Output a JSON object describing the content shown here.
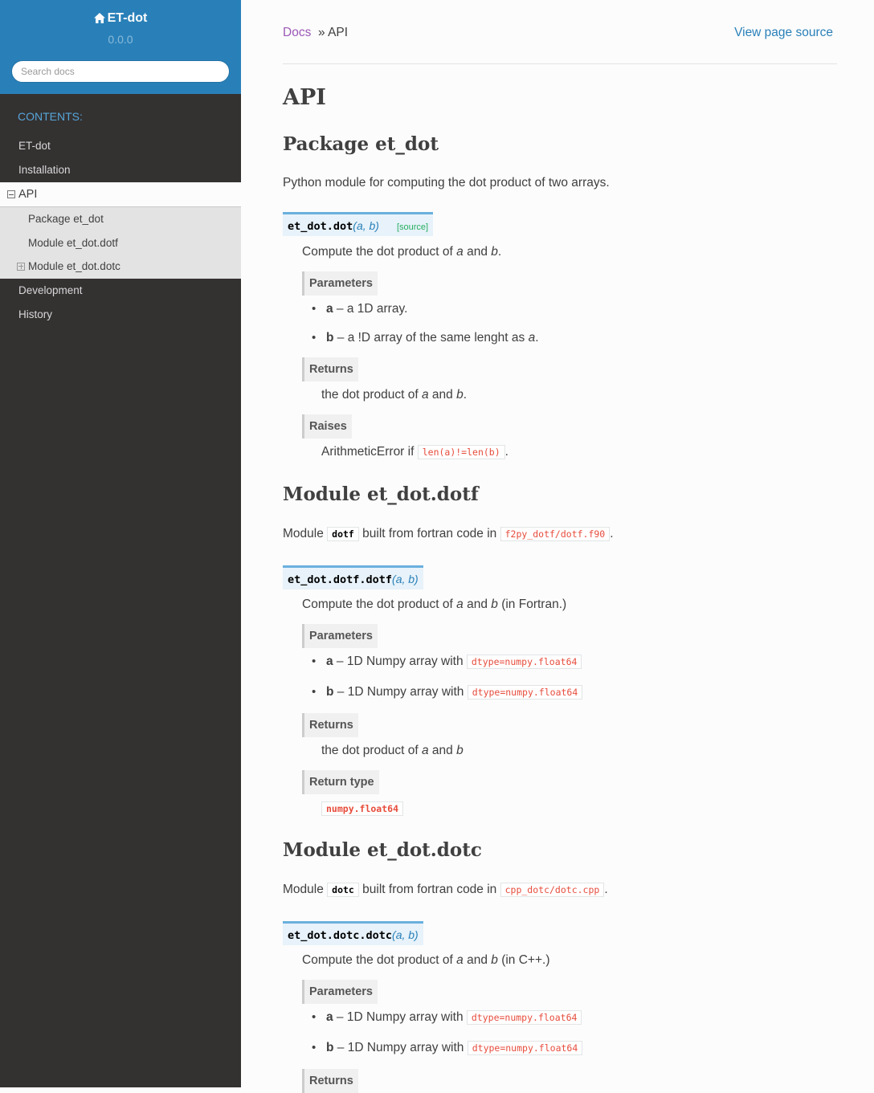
{
  "sidebar": {
    "project": "ET-dot",
    "version": "0.0.0",
    "search_placeholder": "Search docs",
    "caption": "CONTENTS:",
    "items": [
      {
        "label": "ET-dot"
      },
      {
        "label": "Installation"
      },
      {
        "label": "API"
      },
      {
        "label": "Development"
      },
      {
        "label": "History"
      }
    ],
    "subitems": [
      {
        "label": "Package et_dot"
      },
      {
        "label": "Module et_dot.dotf"
      },
      {
        "label": "Module et_dot.dotc"
      }
    ]
  },
  "breadcrumbs": {
    "docs": "Docs",
    "separator": "» API",
    "view_source": "View page source"
  },
  "page": {
    "title": "API",
    "pkg": {
      "heading": "Package et_dot",
      "intro": "Python module for computing the dot product of two arrays.",
      "sig_name": "et_dot.dot",
      "sig_args": "(a, b)",
      "source_link": "[source]",
      "desc_pre": "Compute the dot product of ",
      "a": "a",
      "and": " and ",
      "b": "b",
      "dot": ".",
      "params_label": "Parameters",
      "param_a_desc": " – a 1D array.",
      "param_b_desc": " – a !D array of the same lenght as ",
      "returns_label": "Returns",
      "returns_pre": "the dot product of ",
      "raises_label": "Raises",
      "raises_pre": "ArithmeticError if ",
      "raises_code": "len(a)!=len(b)"
    },
    "dotf": {
      "heading": "Module et_dot.dotf",
      "intro_pre": "Module ",
      "intro_lit": "dotf",
      "intro_mid": " built from fortran code in ",
      "intro_file": "f2py_dotf/dotf.f90",
      "sig_name": "et_dot.dotf.dotf",
      "sig_args": "(a, b)",
      "desc_post": " (in Fortran.)",
      "params_label": "Parameters",
      "param_desc": " – 1D Numpy array with ",
      "param_code": "dtype=numpy.float64",
      "returns_label": "Returns",
      "returns_pre": "the dot product of ",
      "rtype_label": "Return type",
      "rtype": "numpy.float64"
    },
    "dotc": {
      "heading": "Module et_dot.dotc",
      "intro_pre": "Module ",
      "intro_lit": "dotc",
      "intro_mid": " built from fortran code in ",
      "intro_file": "cpp_dotc/dotc.cpp",
      "sig_name": "et_dot.dotc.dotc",
      "sig_args": "(a, b)",
      "desc_post": " (in C++.)",
      "params_label": "Parameters",
      "param_desc": " – 1D Numpy array with ",
      "param_code": "dtype=numpy.float64",
      "returns_label": "Returns"
    }
  }
}
